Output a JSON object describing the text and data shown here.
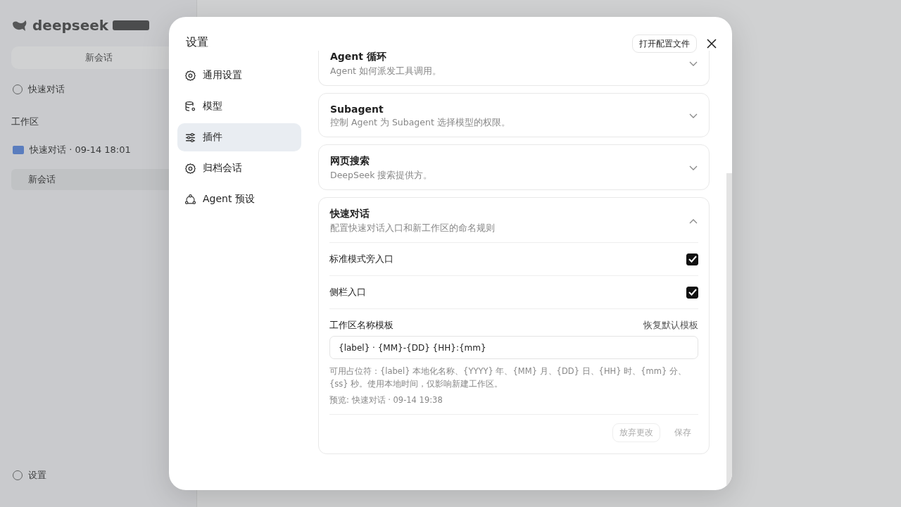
{
  "background": {
    "brand": "deepseek",
    "new_chat": "新会话",
    "quick_chat": "快速对话",
    "workspace_label": "工作区",
    "workspace_item": "快速对话 · 09-14 18:01",
    "session": "新会话",
    "settings": "设置"
  },
  "dialog": {
    "title": "设置",
    "open_config_button": "打开配置文件",
    "nav": [
      {
        "label": "通用设置",
        "kind": "gear",
        "selected": false
      },
      {
        "label": "模型",
        "kind": "database",
        "selected": false
      },
      {
        "label": "插件",
        "kind": "sliders",
        "selected": true
      },
      {
        "label": "归档会话",
        "kind": "gear",
        "selected": false
      },
      {
        "label": "Agent 预设",
        "kind": "agent",
        "selected": false
      }
    ],
    "sections": [
      {
        "title": "Agent 循环",
        "description": "Agent 如何派发工具调用。",
        "expanded": false
      },
      {
        "title": "Subagent",
        "description": "控制 Agent 为 Subagent 选择模型的权限。",
        "expanded": false
      },
      {
        "title": "网页搜索",
        "description": "DeepSeek 搜索提供方。",
        "expanded": false
      },
      {
        "title": "快速对话",
        "description": "配置快速对话入口和新工作区的命名规则",
        "expanded": true
      }
    ],
    "quick_chat": {
      "options": [
        {
          "label": "标准模式旁入口",
          "checked": true
        },
        {
          "label": "侧栏入口",
          "checked": true
        }
      ],
      "template": {
        "label": "工作区名称模板",
        "reset": "恢复默认模板",
        "value": "{label} · {MM}-{DD} {HH}:{mm}",
        "help": "可用占位符：{label} 本地化名称、{YYYY} 年、{MM} 月、{DD} 日、{HH} 时、{mm} 分、{ss} 秒。使用本地时间，仅影响新建工作区。",
        "preview": "预览: 快速对话 · 09-14 19:38"
      },
      "discard_button": {
        "label": "放弃更改",
        "disabled": true
      },
      "save_button": {
        "label": "保存",
        "disabled": true
      }
    }
  }
}
